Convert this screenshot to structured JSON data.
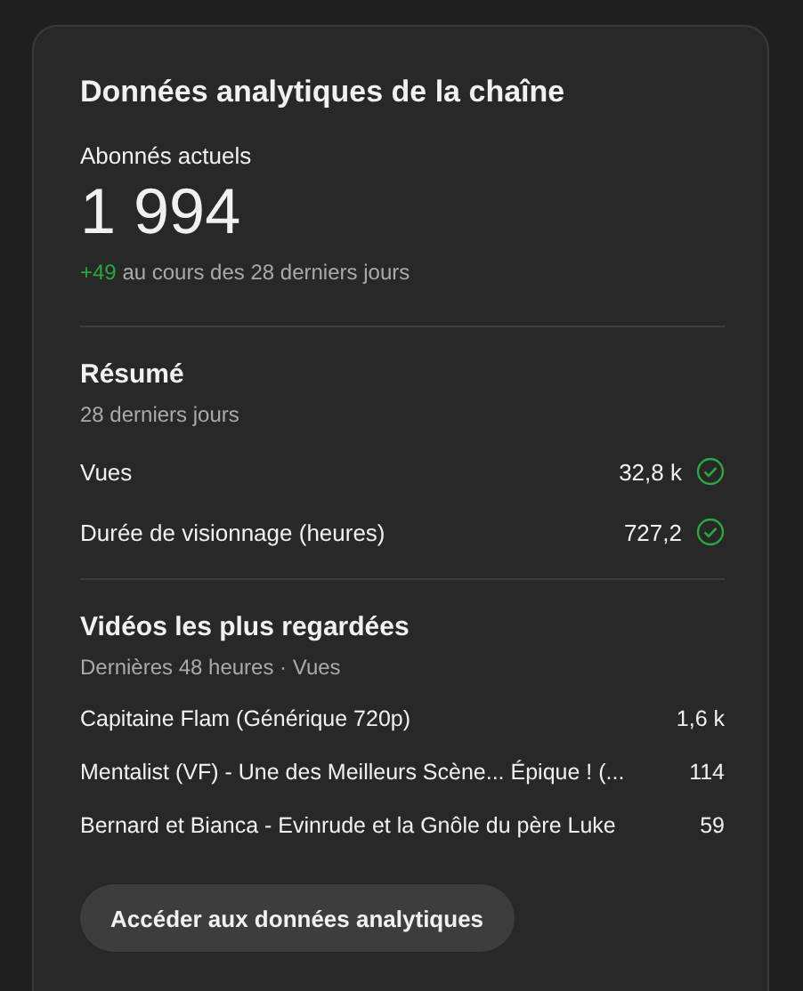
{
  "card": {
    "title": "Données analytiques de la chaîne"
  },
  "subscribers": {
    "label": "Abonnés actuels",
    "value": "1 994",
    "change": "+49",
    "change_text": "au cours des 28 derniers jours"
  },
  "summary": {
    "title": "Résumé",
    "period": "28 derniers jours",
    "metrics": [
      {
        "label": "Vues",
        "value": "32,8 k",
        "checked": true
      },
      {
        "label": "Durée de visionnage (heures)",
        "value": "727,2",
        "checked": true
      }
    ]
  },
  "top_videos": {
    "title": "Vidéos les plus regardées",
    "period": "Dernières 48 heures · Vues",
    "rows": [
      {
        "title": "Capitaine Flam (Générique 720p)",
        "views": "1,6 k"
      },
      {
        "title": "Mentalist (VF) - Une des Meilleurs Scène... Épique ! (...",
        "views": "114"
      },
      {
        "title": "Bernard et Bianca - Evinrude et la Gnôle du père Luke",
        "views": "59"
      }
    ]
  },
  "button": "Accéder aux données analytiques"
}
